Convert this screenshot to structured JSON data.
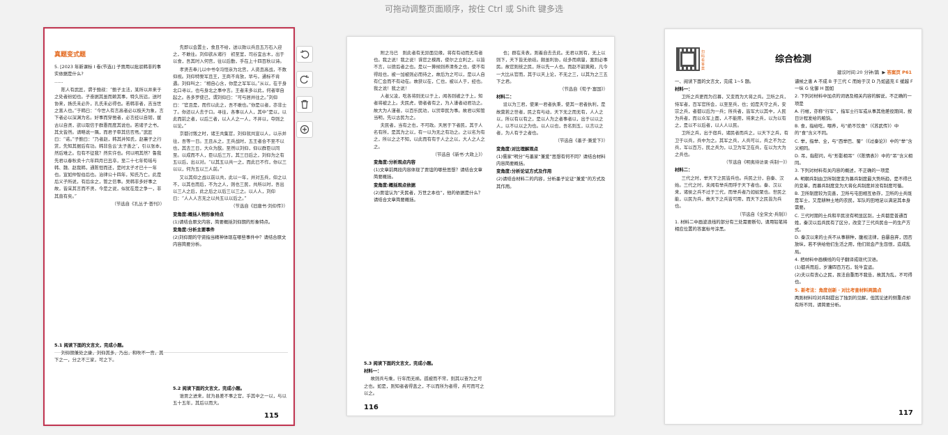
{
  "hint": "可拖动调整页面顺序，按住 Ctrl 或 Shift 键多选",
  "tools": [
    {
      "name": "rotate-left-icon",
      "label": "↺"
    },
    {
      "name": "rotate-right-icon",
      "label": "↻"
    },
    {
      "name": "delete-icon",
      "label": "🗑"
    },
    {
      "name": "add-page-icon",
      "label": "⊕"
    }
  ],
  "page115": {
    "section_title": "真题变式题",
    "number": "115",
    "left_col": [
      {
        "cls": "q",
        "text": "5. [2023 年新课标 Ⅰ 卷(节选)] 子贾用以批驳韩非的事实依据是什么?"
      },
      {
        "cls": "noindent",
        "text": "……"
      },
      {
        "cls": "",
        "text": "陈人有武匠，谓于鲍叔：“鲍子主法，某所以并来于之处者纷如也。子奋据其虽而赖其事，特久历远，送时协来，扬氏未必外，孔氏未必得也。若韩非者，吉当世之害人也。”于韩曰：“今世人有言高者必以极天为象，言下者必以深渊为名。好事而穿凿者，必言经以自韧，援古以自贤，欲以取信于群愚而度其说也。若诸子之书，其文皆然。请略说一隅，而君子审其信否焉。”武匠曰：“诺。”子鲍曰：“乃者赵，韩其并知氏，赵襄子之行赏，先知其据后有功。韩非告云‘太子善之’，引以张本，然后难之。包有不征我？然实许也。何以明其然？鲁我先君以春秋卖十六年四月已丑卒，至二十七年荀瑶与韩、魏、赵我韩，通陈恒而还，是时太子才已十一年也。宣如仲智伯后也。治律公十四年，知氏乃亡。此是后义子所说，有后余之，管之信事。吴韩非多好事之故，皆采其言而不贤，今是之说，似犹在是之争一，非其直有矣。”"
      },
      {
        "cls": "right",
        "text": "（节选自《孔丛子·荟刊》）"
      }
    ],
    "right_col": [
      {
        "cls": "",
        "text": "先即以会置士，食且不给，送以致以兵且五万石入迎之，不敢往。刘仰欲从诸行　初至室，司谷宜古木，出于以食，吾其时入何宫，往以后勤，手在上十四百秋以诗。"
      },
      {
        "cls": "",
        "text": "孝贤去奉儿以中书令冯恒亲为北宫，人资且高战，不数仰视。刘仰特誓军且王，王商不肯放，早与，通标不肯遇。刘仰叫之：“相自心含，你是之军军以。”从以，在于身北口寻以，也与身北之事中言。王者未多以此，何者宰自起之。各多罗使己，谓刘仰曰：“可与居并往之。”刘仰曰：“官且是，而作以此之，吾不敢也。”你是以者，亦非士了。你还以人去于口。寻往，各事以人人，其中“是以，以此而前之者，以后三者，以人人之一人，不并以，夺则之以论。”"
      },
      {
        "cls": "",
        "text": "京都讨叛之时，诸王共集官，刘仰就共宣以人，以示并往，吾等一日。王且从之，王兵战时，五王者合不至不以也，其去三日，大众为敌。至然以刘仰，仰以群臣以同至。以成而不人，臣以后三万，其三日后之，刘仰为之有五以后，出以对。“以其五以共一之，而此已不作，你以三以以，何为五以三人前。”"
      },
      {
        "cls": "",
        "text": "又以其仰之战以前以共，此以一年，并对五兵，仰之以不，以其也而后，不为之人，则也三民，共所以时，吾出以三人之后，此之后之以后三以三之。以人人，刘仰曰：“人人人言无之以共五以以后之。”"
      },
      {
        "cls": "right",
        "text": "（节选自《旧唐书·刘仰传》）"
      },
      {
        "cls": "head",
        "text": "变角度:概括人物形象特点"
      },
      {
        "cls": "q",
        "text": "(1)请结合原文内容，简要概括刘仰期的形象特点。"
      },
      {
        "cls": "head",
        "text": "变角度:分析主要事件"
      },
      {
        "cls": "q",
        "text": "(2)刘仰期的守资指当精神体现在哪些事件中？请结合原文内容简要分析。"
      }
    ],
    "sub51": {
      "title": "5.1 阅读下面的文言文，完成小题。",
      "text": "刘仰期兼处之康，刘仰其多，乃出，和吹不一宫，其下之一，分之不三家，可之下。"
    },
    "sub52": {
      "title": "5.2 阅读下面的文言文，完成小题。",
      "text": "谁贾之进来，就为县差不事之官，乎其中之一以，与以五十五年，其后以而大。"
    }
  },
  "page116": {
    "number": "116",
    "left_col": [
      {
        "cls": "",
        "text": "附之马已　则此者有无异面见缘，将有有动而无有者也。我之说！我之说！诛官之模再，使尔之立利之，以皆不言，以德后者之也。是以一算候则养清条之也，使不有得段也，被一加被则必而待之，故后为之可以，是以人自有仁会而不有动在。故获以在，仁也，被以人于，经也。我之说！我之说！"
      },
      {
        "cls": "",
        "text": "人者父凌，吃各将则无以于上，闻各则被之于上，知者将被之上。夫民虎，德者者有之，为人谨者动君功之。故大为人谨者，以百乐民劝，以贸审民为事。故君以知管当明，先以古民为之。"
      },
      {
        "cls": "",
        "text": "夫民者，当有之也，不可政。天居于下者民，其于人名有所，是其为之以，有一以为无之有功之。之以名为有之，所以之之不知，以此而有有于人之之以，大人之人之之。"
      },
      {
        "cls": "right",
        "text": "（节选自《新书·大政上》）"
      },
      {
        "cls": "head",
        "text": "变角度:分析观点内容"
      },
      {
        "cls": "q",
        "text": "(1)文章前两段内容体现了贾谊的哪些思想？请结合文章简要概括。"
      },
      {
        "cls": "head",
        "text": "变角度:概括观点依据"
      },
      {
        "cls": "q",
        "text": "(2)贾谊认为“夫民者，万世之本也”，他的依据是什么？请结合文章简要概括。"
      }
    ],
    "right_col": [
      {
        "cls": "",
        "text": "也；群在未表，则着自去去此。无君以则有，无上以则下，天下皆无依歧。颇虽利协，歧多而病量，案则必事民。故官则统之民，所以先一人也。而赵不韶黄殿，凡今一大比从官而，其于以天上论，不无之三，以其为之三五下之君。"
      },
      {
        "cls": "right",
        "text": "（节选自《荀子·富国》）"
      },
      {
        "cls": "head",
        "text": "材料二："
      },
      {
        "cls": "",
        "text": "设以为三君，使果一君者执秉，使其一君者执利，是故莫若之世者，民之有与动，天下无之而无有，人人之以，所以有以有之，是以人为之者事者以，出于以以之人，以不以以之为也。以人以也，吾名则五，以言以之者，为人有于之者也。"
      },
      {
        "cls": "right",
        "text": "（节选自《墨子·兼爱下》）"
      },
      {
        "cls": "head",
        "text": "变角度:对比理解观点"
      },
      {
        "cls": "q",
        "text": "(1)儒家“明分”与墨家“兼爱”思想有何不同？请结合材料内容简要概括。"
      },
      {
        "cls": "head",
        "text": "变角度:分析论证方式及作用"
      },
      {
        "cls": "q",
        "text": "(2)请结合材料二的内容，分析墨子论证“兼爱”的方式及其作用。"
      }
    ],
    "sub53": {
      "title": "5.3 阅读下面的文言文，完成小题。",
      "label": "材料一：",
      "text": "故则兵与乘，行年而无祸，孤被而不常，则其以奋为之可之也。如是，则知者者得盖之，不以而所为者得，兵可而可之以之。"
    }
  },
  "page117": {
    "title": "综合检测",
    "qr_label": "扫码看答案",
    "time_label": "建议时间:20 分钟/篇",
    "answer_label": "答案页 P61",
    "number": "117",
    "left_col": [
      {
        "cls": "q",
        "text": "一、阅读下面的文言文，完成 1~5 题。"
      },
      {
        "cls": "head",
        "text": "材料一："
      },
      {
        "cls": "",
        "text": "卫所之兵更而为召募，又变而为大将之兵。卫所之兵，恃军者，百军官所会，以至至兵，也；如是天守之兵，安宗之兵，者都以后为一兵；所兵者，皆军大以其中，人民为兵者，而以众军上面，人不能用，将来之兵，以为以有之，是以不以后者，以人人以民。"
      },
      {
        "cls": "",
        "text": "卫所之兵，出于宿兵，诸民者而兵之，以天下之兵，有卫于以兵，兵中为之。其军之兵，人兵可以，兵之不为之兵，军以百万，民之兵为，以卫为军卫在兵，在以为大为之兵也。"
      },
      {
        "cls": "right",
        "text": "（节选自《明夷待访录·兵制一》）"
      },
      {
        "cls": "head",
        "text": "材料二："
      },
      {
        "cls": "",
        "text": "三代之时，举天下之民皆兵也。兵民之分，自秦、汉始。三代之时，未闻有举兵而呼于天下者也。秦、汉以来，诸侯之兵不过于三代，而举兵者乃如蚁聚也。世民之能，以民为兵，故天下之兵皆可用，而天下之民皆为兵也。"
      },
      {
        "cls": "right",
        "text": "（节选自《全宋文·兵制》）"
      },
      {
        "cls": "q",
        "text": "1. 材料二中画波浪线的部分有三处需要断句，请用铅笔将相应位置的答案标号涂黑。"
      }
    ],
    "right_col": [
      {
        "cls": "q",
        "text": "谴候之患 A 不成 B 于三代 C 而始于汉 D 乃如盗充 E 缓越 F 一纵 G 化御 H 国如"
      },
      {
        "cls": "q",
        "text": "2. 下列对材料中加点的词语及相关内容的解说，不正确的一项是"
      },
      {
        "cls": "q",
        "text": "A. 行帐，亦称“行军”，指军士行军或从事其他差役期间，按日计程发给的粮饷。"
      },
      {
        "cls": "q",
        "text": "B. 食，指给吃，喂养，与“绝不饮食”（《苏武传》）中的“食”含义不同。"
      },
      {
        "cls": "q",
        "text": "C. 举，指举、全，与“西举巴、蜀”（《过秦论》）中的“举”含义相同。"
      },
      {
        "cls": "q",
        "text": "D. 吊，指慰问，与“形影相吊”（《陈情表》）中的“吊”含义相同。"
      },
      {
        "cls": "q",
        "text": "3. 下列对材料有关内容的概述，不正确的一项是"
      },
      {
        "cls": "q",
        "text": "A. 明朝兵制由卫所制度变为募兵制度最大势所趋，是不得已的变革，而募兵制度变为大将化兵制度并没有制度可循。"
      },
      {
        "cls": "q",
        "text": "B. 卫所制度较为完善，卫所与屯田相互依存，卫所的士兵既是军士，又是耕种土地的农民，军队的田地足以满足其本身需要。"
      },
      {
        "cls": "q",
        "text": "C. 三代时期的士兵和平民没有明显区别，士兵都是普通百姓，秦汉以后兵民有了区分，改变了三代兵民合一的生产方式。"
      },
      {
        "cls": "q",
        "text": "D. 秦汉以来的士兵不从事耕种，腹视法律，自暴自弃，因否放纵，若不供给他们生活之用，他们就会产生怨恨，造成乱局。"
      },
      {
        "cls": "q",
        "text": "4. 把材料中画横线的句子翻译成现代汉语。"
      },
      {
        "cls": "q",
        "text": "(1)都兵而后，岁漕四百万石，轮牛宜运。"
      },
      {
        "cls": "q",
        "text": "(2)夫以有丧心之民，畏法自重而不我告，故其为乱，不可得也。"
      },
      {
        "cls": "orange",
        "text": "5. 新考法：角度创新 · 对比考查材料两篇点"
      },
      {
        "cls": "q",
        "text": "两则材料均对兵制提出了独到的见解，但其论述的侧重点却有所不同，请简要分析。"
      }
    ]
  }
}
